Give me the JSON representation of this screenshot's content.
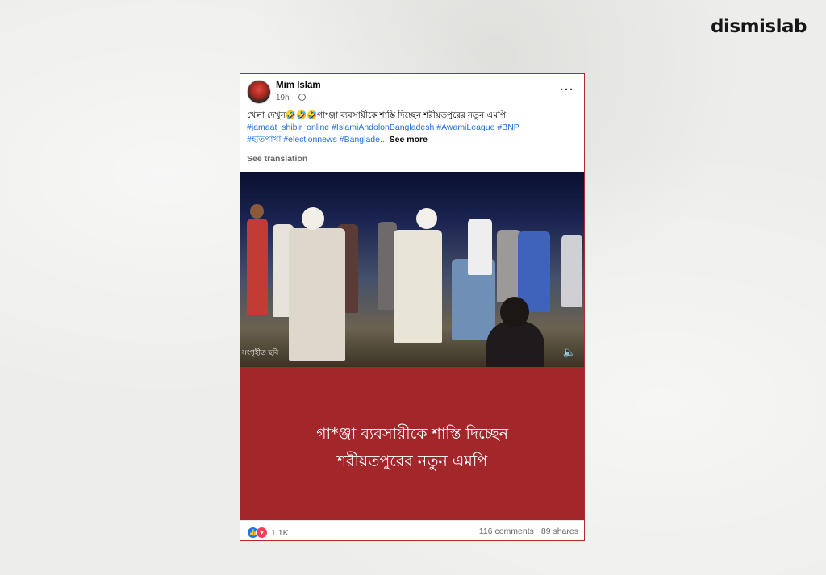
{
  "brand": "dismislab",
  "post": {
    "author": "Mim Islam",
    "time": "19h ·",
    "text_main": "খেলা দেখুন🤣🤣🤣গা*ঞ্জা ব্যবসায়ীকে শাস্তি দিচ্ছেন শরীয়তপুরের নতুন এমপি",
    "hashtags_line1": "#jamaat_shibir_online #IslamiAndolonBangladesh #AwamiLeague #BNP",
    "hashtags_line2": "#হাতপাখা #electionnews #Banglade...",
    "see_more": "See more",
    "see_translation": "See translation",
    "more_icon": "···"
  },
  "video": {
    "watermark": "সংগৃহীত ছবি",
    "volume_icon": "🔈"
  },
  "banner": {
    "line1": "গা*ঞ্জা ব্যবসায়ীকে শাস্তি দিচ্ছেন",
    "line2": "শরীয়তপুরের নতুন এমপি",
    "color": "#a3262b"
  },
  "footer": {
    "reaction_count": "1.1K",
    "comments": "116 comments",
    "shares": "89 shares",
    "like_icon": "👍",
    "love_icon": "♥"
  }
}
